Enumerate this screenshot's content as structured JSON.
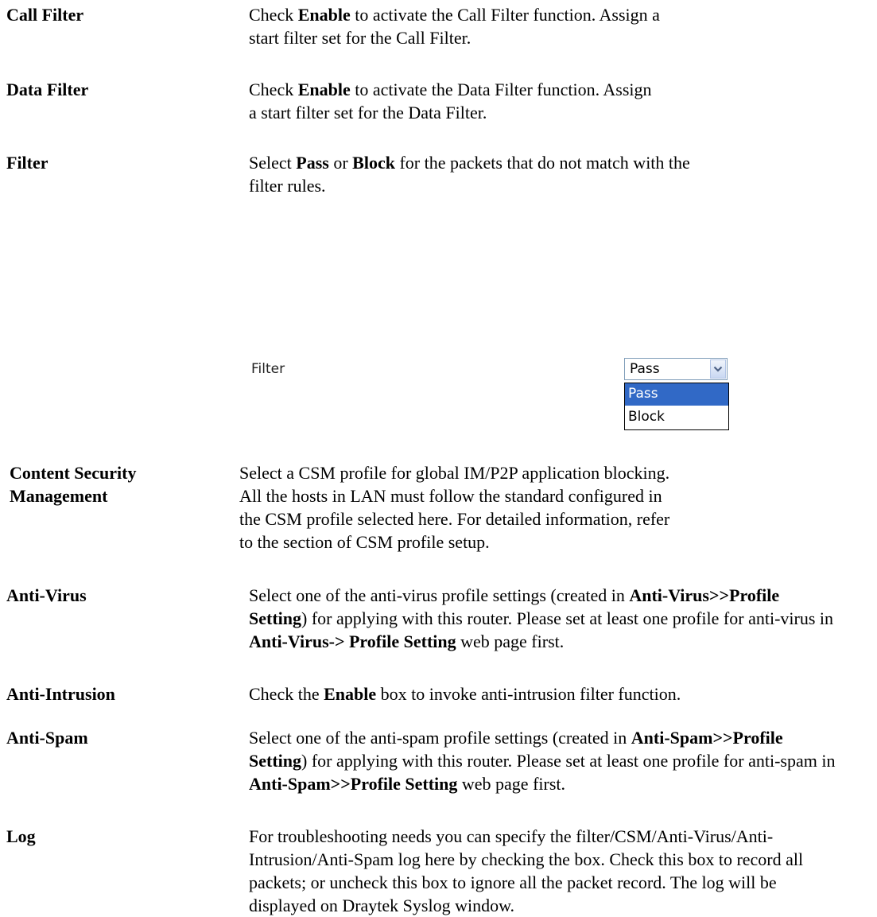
{
  "entries": [
    {
      "term": "Call Filter",
      "desc_html": "Check <b>Enable</b> to activate the Call Filter function. Assign a start filter set for the Call Filter."
    },
    {
      "term": "Data Filter",
      "desc_html": "Check <b>Enable</b> to activate the Data Filter function. Assign a start filter set for the Data Filter."
    },
    {
      "term": "Filter",
      "desc_html": "Select <b>Pass</b> or <b>Block</b> for the packets that do not match with the filter rules."
    },
    {
      "term_lines": [
        "Content Security",
        "Management"
      ],
      "desc_html": "Select a CSM profile for global IM/P2P application blocking. All the hosts in LAN must follow the standard configured in the CSM profile selected here. For detailed information, refer to the section of CSM profile setup."
    },
    {
      "term": "Anti-Virus",
      "desc_html": "Select one of the anti-virus profile settings (created in <b>Anti-Virus&gt;&gt;Profile Setting</b>) for applying with this router. Please set at least one profile for anti-virus in <b>Anti-Virus-&gt; Profile Setting</b> web page first."
    },
    {
      "term": "Anti-Intrusion",
      "desc_html": "Check the <b>Enable</b> box to invoke anti-intrusion filter function."
    },
    {
      "term": "Anti-Spam",
      "desc_html": "Select one of the anti-spam profile settings (created in <b>Anti-Spam&gt;&gt;Profile Setting</b>) for applying with this router. Please set at least one profile for anti-spam in <b>Anti-Spam&gt;&gt;Profile Setting</b> web page first."
    },
    {
      "term": "Log",
      "desc_html": "For troubleshooting needs you can specify the filter/CSM/Anti-Virus/Anti-Intrusion/Anti-Spam log here by checking the box. Check this box to record all packets; or uncheck this box to ignore all the packet record. The log will be displayed on Draytek Syslog window."
    }
  ],
  "filter_widget": {
    "label": "Filter",
    "selected_value": "Pass",
    "options": [
      "Pass",
      "Block"
    ],
    "highlighted_option": "Pass",
    "highlight_color": "#3169c6",
    "arrow_icon": "chevron-down-icon"
  }
}
